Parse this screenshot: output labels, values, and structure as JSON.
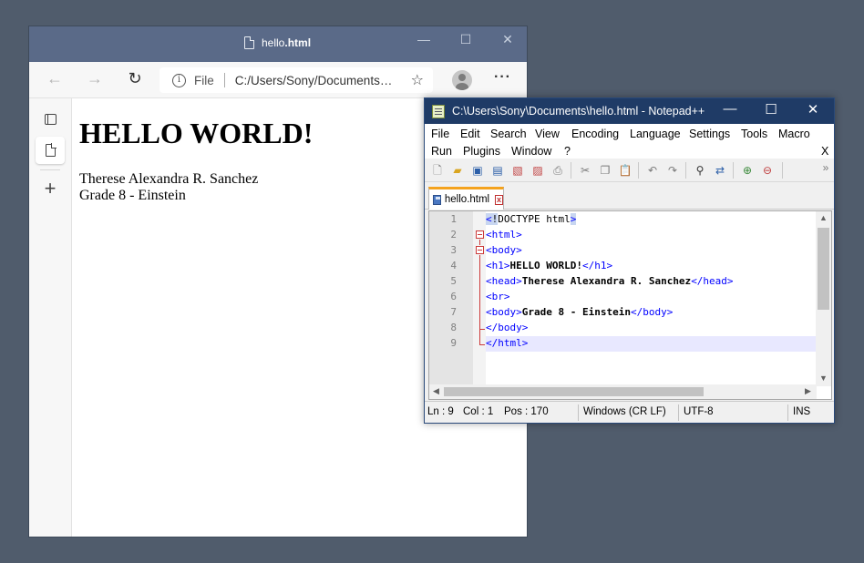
{
  "browser": {
    "tab_title_prefix": "hello",
    "tab_title_suffix": ".html",
    "address_label": "File",
    "address_url": "C:/Users/Sony/Documents/hello.html",
    "content": {
      "heading": "HELLO WORLD!",
      "line1": "Therese Alexandra R. Sanchez",
      "line2": "Grade 8 - Einstein"
    }
  },
  "notepad": {
    "title": "C:\\Users\\Sony\\Documents\\hello.html - Notepad++",
    "menu_row1": [
      "File",
      "Edit",
      "Search",
      "View",
      "Encoding",
      "Language",
      "Settings",
      "Tools",
      "Macro"
    ],
    "menu_row2": [
      "Run",
      "Plugins",
      "Window",
      "?"
    ],
    "menu_close": "X",
    "tab_label": "hello.html",
    "line_numbers": [
      "1",
      "2",
      "3",
      "4",
      "5",
      "6",
      "7",
      "8",
      "9"
    ],
    "code": {
      "l1_tag_open": "<",
      "l1_hl": "!",
      "l1_doc": "DOCTYPE html",
      "l1_tag_close": ">",
      "l2": "<html>",
      "l3": "<body>",
      "l4_open": "<h1>",
      "l4_text": "HELLO WORLD!",
      "l4_close": "</h1>",
      "l5_open": "<head>",
      "l5_text": "Therese Alexandra R. Sanchez",
      "l5_close": "</head>",
      "l6": "<br>",
      "l7_open": "<body>",
      "l7_text": "Grade 8 - Einstein",
      "l7_close": "</body>",
      "l8": "</body>",
      "l9": "</html>"
    },
    "status": {
      "ln": "Ln : 9",
      "col": "Col : 1",
      "pos": "Pos : 170",
      "eol": "Windows (CR LF)",
      "encoding": "UTF-8",
      "mode": "INS"
    }
  }
}
